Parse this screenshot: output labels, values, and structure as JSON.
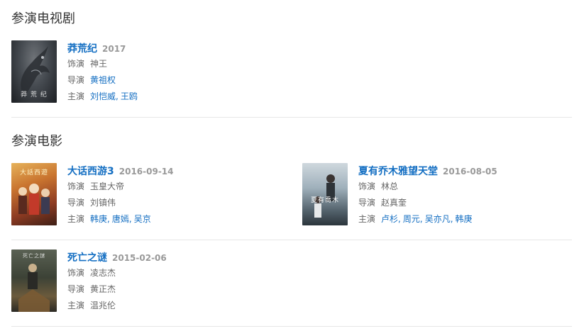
{
  "tv_section": {
    "title": "参演电视剧",
    "items": [
      {
        "title": "莽荒纪",
        "year": "2017",
        "role_label": "饰演",
        "role": "神王",
        "director_label": "导演",
        "directors": [
          "黄祖权"
        ],
        "cast_label": "主演",
        "cast": [
          "刘恺威",
          "王鸥"
        ]
      }
    ]
  },
  "movie_section": {
    "title": "参演电影",
    "items": [
      {
        "title": "大话西游3",
        "year": "2016-09-14",
        "role_label": "饰演",
        "role": "玉皇大帝",
        "director_label": "导演",
        "directors": [
          "刘镇伟"
        ],
        "cast_label": "主演",
        "cast": [
          "韩庚",
          "唐嫣",
          "吴京"
        ]
      },
      {
        "title": "夏有乔木雅望天堂",
        "year": "2016-08-05",
        "role_label": "饰演",
        "role": "林总",
        "director_label": "导演",
        "directors": [
          "赵真奎"
        ],
        "cast_label": "主演",
        "cast": [
          "卢杉",
          "周元",
          "吴亦凡",
          "韩庚"
        ]
      },
      {
        "title": "死亡之谜",
        "year": "2015-02-06",
        "role_label": "饰演",
        "role": "凌志杰",
        "director_label": "导演",
        "directors": [
          "黄正杰"
        ],
        "cast_label": "主演",
        "cast": [
          "温兆伦"
        ]
      }
    ]
  },
  "colors": {
    "link": "#136ec2",
    "muted_text": "#999999",
    "label_text": "#666666",
    "divider": "#e6e6e6"
  }
}
